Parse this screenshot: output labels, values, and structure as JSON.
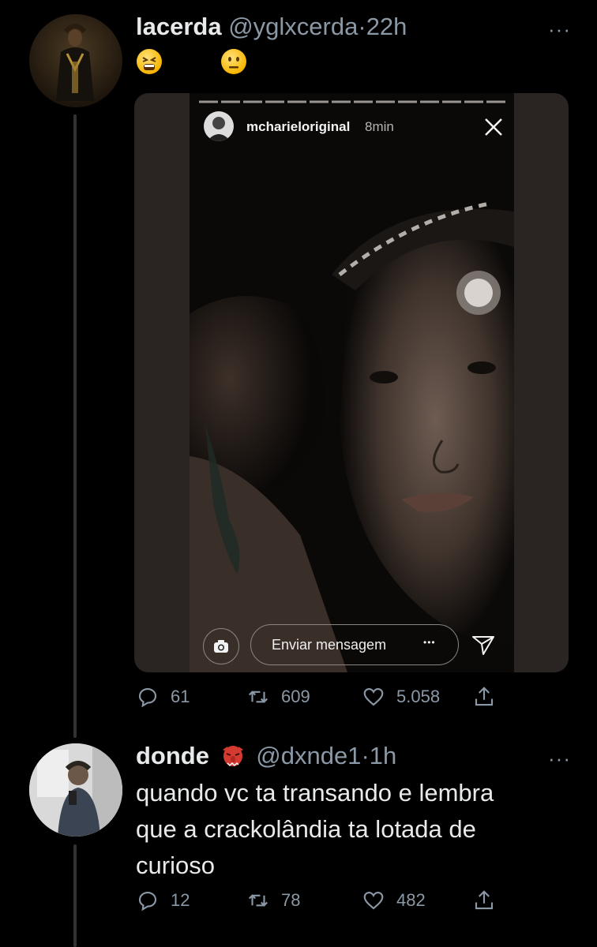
{
  "tweet1": {
    "name": "lacerda",
    "handle": "@yglxcerda",
    "separator": "·",
    "time": "22h",
    "more_label": "···",
    "media": {
      "story_username": "mcharieloriginal",
      "story_time": "8min",
      "message_placeholder": "Enviar mensagem",
      "message_more": "•••"
    },
    "stats": {
      "replies": "61",
      "retweets": "609",
      "likes": "5.058"
    }
  },
  "tweet2": {
    "name": "donde",
    "handle": "@dxnde1",
    "separator": "·",
    "time": "1h",
    "more_label": "···",
    "text_lines": [
      "quando vc ta transando e lembra",
      "que a crackolândia ta lotada de",
      "curioso"
    ],
    "stats": {
      "replies": "12",
      "retweets": "78",
      "likes": "482"
    }
  },
  "colors": {
    "background": "#000000",
    "text": "#e7e9ea",
    "secondary": "#8b98a5",
    "thread_line": "#2f3336"
  }
}
